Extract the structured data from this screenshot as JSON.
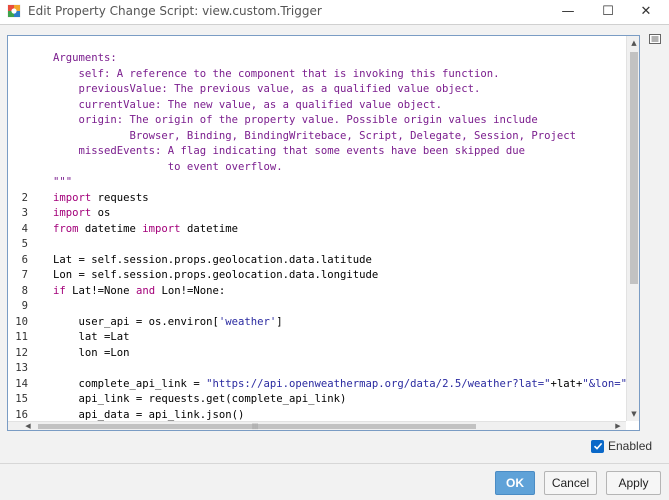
{
  "window": {
    "title": "Edit Property Change Script: view.custom.Trigger",
    "minimize_glyph": "—",
    "maximize_glyph": "☐",
    "close_glyph": "✕"
  },
  "editor": {
    "lines": [
      {
        "num": "",
        "parts": [
          {
            "t": "Arguments:",
            "c": "doc"
          }
        ]
      },
      {
        "num": "",
        "parts": [
          {
            "t": "    self: A reference to the component that is invoking this function.",
            "c": "doc"
          }
        ]
      },
      {
        "num": "",
        "parts": [
          {
            "t": "    previousValue: The previous value, as a qualified value object.",
            "c": "doc"
          }
        ]
      },
      {
        "num": "",
        "parts": [
          {
            "t": "    currentValue: The new value, as a qualified value object.",
            "c": "doc"
          }
        ]
      },
      {
        "num": "",
        "parts": [
          {
            "t": "    origin: The origin of the property value. Possible origin values include",
            "c": "doc"
          }
        ]
      },
      {
        "num": "",
        "parts": [
          {
            "t": "            Browser, Binding, BindingWritebace, Script, Delegate, Session, Project",
            "c": "doc"
          }
        ]
      },
      {
        "num": "",
        "parts": [
          {
            "t": "    missedEvents: A flag indicating that some events have been skipped due",
            "c": "doc"
          }
        ]
      },
      {
        "num": "",
        "parts": [
          {
            "t": "                  to event overflow.",
            "c": "doc"
          }
        ]
      },
      {
        "num": "",
        "parts": [
          {
            "t": "\"\"\"",
            "c": "doc"
          }
        ]
      },
      {
        "num": "2",
        "parts": [
          {
            "t": "import",
            "c": "kw"
          },
          {
            "t": " requests",
            "c": ""
          }
        ]
      },
      {
        "num": "3",
        "parts": [
          {
            "t": "import",
            "c": "kw"
          },
          {
            "t": " os",
            "c": ""
          }
        ]
      },
      {
        "num": "4",
        "parts": [
          {
            "t": "from",
            "c": "kw"
          },
          {
            "t": " datetime ",
            "c": ""
          },
          {
            "t": "import",
            "c": "kw"
          },
          {
            "t": " datetime",
            "c": ""
          }
        ]
      },
      {
        "num": "5",
        "parts": []
      },
      {
        "num": "6",
        "parts": [
          {
            "t": "Lat = self.session.props.geolocation.data.latitude",
            "c": ""
          }
        ]
      },
      {
        "num": "7",
        "parts": [
          {
            "t": "Lon = self.session.props.geolocation.data.longitude",
            "c": ""
          }
        ]
      },
      {
        "num": "8",
        "parts": [
          {
            "t": "if",
            "c": "kw"
          },
          {
            "t": " Lat!=None ",
            "c": ""
          },
          {
            "t": "and",
            "c": "kw"
          },
          {
            "t": " Lon!=None:",
            "c": ""
          }
        ]
      },
      {
        "num": "9",
        "parts": []
      },
      {
        "num": "10",
        "parts": [
          {
            "t": "    user_api = os.environ[",
            "c": ""
          },
          {
            "t": "'weather'",
            "c": "str"
          },
          {
            "t": "]",
            "c": ""
          }
        ]
      },
      {
        "num": "11",
        "parts": [
          {
            "t": "    lat =Lat",
            "c": ""
          }
        ]
      },
      {
        "num": "12",
        "parts": [
          {
            "t": "    lon =Lon",
            "c": ""
          }
        ]
      },
      {
        "num": "13",
        "parts": []
      },
      {
        "num": "14",
        "parts": [
          {
            "t": "    complete_api_link = ",
            "c": ""
          },
          {
            "t": "\"https://api.openweathermap.org/data/2.5/weather?lat=\"",
            "c": "str"
          },
          {
            "t": "+lat+",
            "c": ""
          },
          {
            "t": "\"&lon=\"",
            "c": "str"
          },
          {
            "t": "+lon+",
            "c": ""
          },
          {
            "t": "\"",
            "c": "str"
          }
        ]
      },
      {
        "num": "15",
        "parts": [
          {
            "t": "    api_link = requests.get(complete_api_link)",
            "c": ""
          }
        ]
      },
      {
        "num": "16",
        "parts": [
          {
            "t": "    api_data = api_link.json()",
            "c": ""
          }
        ]
      }
    ],
    "vscroll_position": 0.0,
    "hscroll_position": 0.0
  },
  "enabled": {
    "label": "Enabled",
    "checked": true
  },
  "buttons": {
    "ok": "OK",
    "cancel": "Cancel",
    "apply": "Apply"
  },
  "colors": {
    "docstring": "#7b1e8e",
    "keyword": "#a3007a",
    "string": "#2a2aa0",
    "ok_button": "#5fa2d8",
    "checkbox": "#0a68c8"
  }
}
